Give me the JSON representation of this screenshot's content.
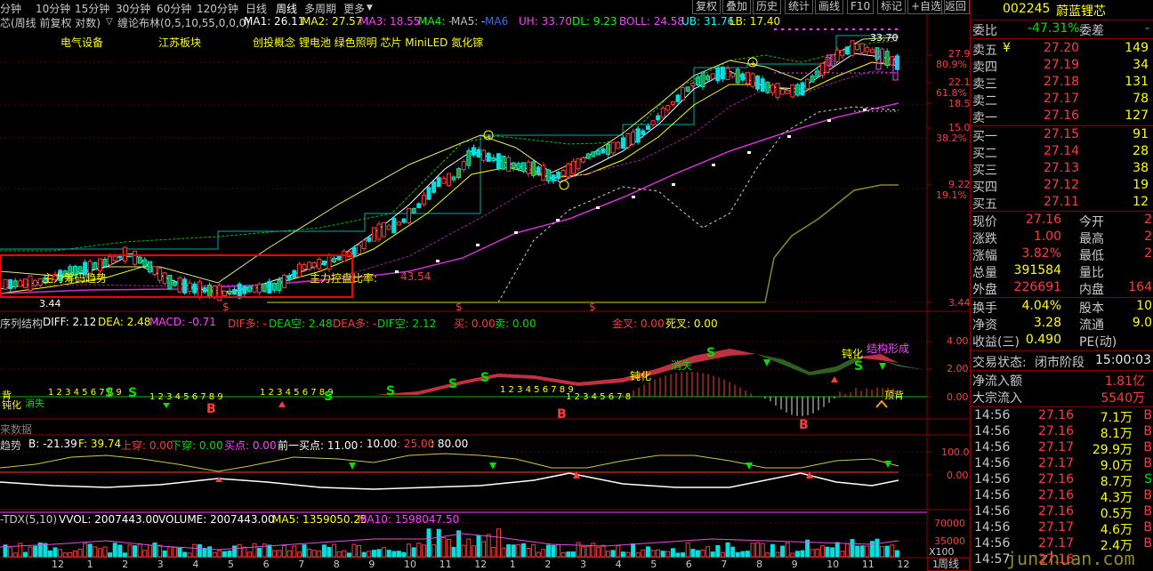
{
  "toolbar": {
    "periods": [
      "分钟",
      "10分钟",
      "15分钟",
      "30分钟",
      "60分钟",
      "120分钟",
      "日线",
      "周线",
      "多周期",
      "更多"
    ],
    "active_period": "周线",
    "buttons": [
      "复权",
      "叠加",
      "历史",
      "统计",
      "画线",
      "F10",
      "标记",
      "+自选",
      "返回"
    ]
  },
  "info": {
    "name": "芯(周线 前复权 对数)",
    "indicator": "缠论布林(0,5,10,55,0,0,0)",
    "ma1": "MA1: 26.11",
    "ma2": "MA2: 27.57",
    "ma3": "MA3: 18.55",
    "ma4": "MA4: -",
    "ma5": "MA5: -",
    "ma6": "MA6",
    "uh": "UH: 33.70",
    "dl": "DL: 9.23",
    "boll": "BOLL: 24.58",
    "ub": "UB: 31.76",
    "lb": "LB: 17.40"
  },
  "concepts": {
    "c1": "电气设备",
    "c2": "江苏板块",
    "c3": "创投概念 锂电池 绿色照明 芯片 MiniLED 氮化镓"
  },
  "main_chart": {
    "price_ticks": [
      "27.92",
      "22.14",
      "18.57",
      "15.00",
      "9.22",
      "3.44"
    ],
    "pct_ticks": [
      "80.9%",
      "61.8%",
      "38.2%",
      "19.1%"
    ],
    "peak_label": "33.70",
    "low_label": "3.44",
    "box_text1": "主力筹码趋势",
    "box_text2": "主力控盘比率:",
    "box_value": "43.54",
    "dollar_signs": [
      "$",
      "$",
      "$"
    ]
  },
  "macd_panel": {
    "title": "序列结构",
    "diff": "DIFF: 2.12",
    "dea": "DEA: 2.48",
    "macd": "MACD: -0.71",
    "dif_up": "DIF多: -",
    "dea_kong": "DEA空: 2.48",
    "dea_duo": "DEA多: -",
    "dif_kong": "DIF空: 2.12",
    "buy": "买: 0.00",
    "sell": "卖: 0.00",
    "gold": "金叉: 0.00",
    "dead": "死叉: 0.00",
    "ticks": [
      "4.00",
      "2.00",
      "0.00"
    ],
    "labels": {
      "dunhua1": "钝化",
      "xiaoshi1": "消失",
      "dunhua2": "钝化",
      "xiaoshi2": "消失",
      "dunhua3": "钝化",
      "jiegou": "结构形成",
      "dingbei": "顶背",
      "dibei": "背"
    },
    "seq1": "1 2 3 4 5 6 7 8 9",
    "seq2": "1 2 3 4 5 6 7 8 9",
    "seq3": "1 2 3 4 5 6 7 8 9",
    "seq4": "1 2 3 4 5 6 7 8 9",
    "seq5": "1 2 3 4 5 6 7 8"
  },
  "future_label": "来数据",
  "trend_panel": {
    "title": "趋势",
    "b": "B: -21.39",
    "f": "F: 39.74",
    "up": "上穿: 0.00",
    "down": "下穿: 0.00",
    "buypt": "买点: 0.00",
    "prev": "前一买点: 11.00",
    "v1": ": 10.00",
    "v2": ": 25.00",
    "v3": ": 80.00",
    "ticks": [
      "100.0",
      "0.00"
    ]
  },
  "vol_panel": {
    "title": "-TDX(5,10)",
    "vol": "VVOL: 2007443.00",
    "volume": "VOLUME: 2007443.00",
    "ma5": "MA5: 1359050.25",
    "ma10": "MA10: 1598047.50",
    "ticks": [
      "70000",
      "35000"
    ],
    "unit": "X100"
  },
  "x_axis": {
    "labels": [
      "12",
      "1",
      "2",
      "3",
      "4",
      "5",
      "6",
      "7",
      "8",
      "9",
      "10",
      "11",
      "12",
      "1",
      "2",
      "3",
      "4",
      "5",
      "6",
      "7",
      "8",
      "9",
      "10",
      "11",
      "12",
      "1"
    ],
    "tab": "周线"
  },
  "quote": {
    "code": "002245",
    "name": "蔚蓝锂芯",
    "webi_label": "委比",
    "webi": "-47.31%",
    "weicha_label": "委差",
    "weicha": "-",
    "asks": [
      {
        "label": "卖五",
        "flag": "¥",
        "price": "27.20",
        "vol": "149"
      },
      {
        "label": "卖四",
        "flag": "",
        "price": "27.19",
        "vol": "34"
      },
      {
        "label": "卖三",
        "flag": "",
        "price": "27.18",
        "vol": "131"
      },
      {
        "label": "卖二",
        "flag": "",
        "price": "27.17",
        "vol": "78"
      },
      {
        "label": "卖一",
        "flag": "",
        "price": "27.16",
        "vol": "127"
      }
    ],
    "bids": [
      {
        "label": "买一",
        "price": "27.15",
        "vol": "91"
      },
      {
        "label": "买二",
        "price": "27.14",
        "vol": "28"
      },
      {
        "label": "买三",
        "price": "27.13",
        "vol": "38"
      },
      {
        "label": "买四",
        "price": "27.12",
        "vol": "19"
      },
      {
        "label": "买五",
        "price": "27.11",
        "vol": "12"
      }
    ],
    "stats": [
      {
        "l1": "现价",
        "v1": "27.16",
        "c1": "red",
        "l2": "今开",
        "v2": "2"
      },
      {
        "l1": "涨跌",
        "v1": "1.00",
        "c1": "red",
        "l2": "最高",
        "v2": "2"
      },
      {
        "l1": "涨幅",
        "v1": "3.82%",
        "c1": "red",
        "l2": "最低",
        "v2": "2"
      },
      {
        "l1": "总量",
        "v1": "391584",
        "c1": "yellow",
        "l2": "量比",
        "v2": ""
      },
      {
        "l1": "外盘",
        "v1": "226691",
        "c1": "red",
        "l2": "内盘",
        "v2": "164"
      }
    ],
    "stats2": [
      {
        "l1": "换手",
        "v1": "4.04%",
        "c1": "yellow",
        "l2": "股本",
        "v2": "10"
      },
      {
        "l1": "净资",
        "v1": "3.28",
        "c1": "yellow",
        "l2": "流通",
        "v2": "9.0"
      },
      {
        "l1": "收益(三)",
        "v1": "0.490",
        "c1": "yellow",
        "l2": "PE(动)",
        "v2": ""
      }
    ],
    "trade_status_label": "交易状态:",
    "trade_status": "闭市阶段",
    "trade_time": "15:00:03",
    "net_in_label": "净流入额",
    "net_in": "1.81亿",
    "block_in_label": "大宗流入",
    "block_in": "5540万",
    "ticks": [
      {
        "t": "14:56",
        "p": "27.16",
        "v": "7.1万",
        "s": "B"
      },
      {
        "t": "14:56",
        "p": "27.16",
        "v": "8.1万",
        "s": "B"
      },
      {
        "t": "14:56",
        "p": "27.17",
        "v": "29.9万",
        "s": "B"
      },
      {
        "t": "14:56",
        "p": "27.17",
        "v": "9.0万",
        "s": "B"
      },
      {
        "t": "14:56",
        "p": "27.16",
        "v": "8.7万",
        "s": "S"
      },
      {
        "t": "14:56",
        "p": "27.16",
        "v": "4.3万",
        "s": "B"
      },
      {
        "t": "14:56",
        "p": "27.16",
        "v": "0.5万",
        "s": "B"
      },
      {
        "t": "14:56",
        "p": "27.17",
        "v": "4.6万",
        "s": "B"
      },
      {
        "t": "14:56",
        "p": "27.17",
        "v": "2.4万",
        "s": "B"
      },
      {
        "t": "14:57",
        "p": "27.16",
        "v": "",
        "s": ""
      }
    ],
    "watermark": "junzhuan.com"
  },
  "colors": {
    "up": "#ff3c3c",
    "down": "#00e0e0",
    "green": "#00e000",
    "bg": "#000000",
    "panel_border": "#8a0000"
  }
}
